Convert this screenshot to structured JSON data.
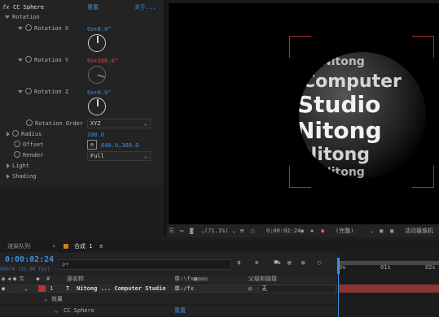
{
  "effects": {
    "fx": "fx",
    "name": "CC Sphere",
    "reset": "重置",
    "about": "关于...",
    "group_rotation": "Rotation",
    "rotation_x_label": "Rotation X",
    "rotation_x_value": "0x+0.0°",
    "rotation_y_label": "Rotation Y",
    "rotation_y_value": "0x+106.6°",
    "rotation_z_label": "Rotation Z",
    "rotation_z_value": "0x+0.0°",
    "rotation_order_label": "Rotation Order",
    "rotation_order_value": "XYZ",
    "radius_label": "Radius",
    "radius_value": "200.0",
    "offset_label": "Offset",
    "offset_value": "640.0,360.0",
    "render_label": "Render",
    "render_value": "Full",
    "light_label": "Light",
    "shading_label": "Shading"
  },
  "viewer": {
    "sphere_words": [
      "Nitong",
      "Computer",
      "Studio",
      "Nitong",
      "Nitong",
      "Nitong"
    ],
    "zoom": "(71.1%)",
    "timecode": "0:00:02:24",
    "quality": "(完整)",
    "camera": "活动摄像机"
  },
  "tabs": {
    "render_queue": "渲染队列",
    "comp": "合成 1",
    "menu": "≡"
  },
  "timeline": {
    "timecode": "0:00:02:24",
    "frame_info": "00074 (25.00 fps)",
    "search_placeholder": "ρ▾",
    "col_source_name": "源名称",
    "col_switches": "单☆\\fx▦◎◎◎",
    "col_parent": "父级和链接",
    "layer_index": "1",
    "layer_type": "T",
    "layer_name": "Nitong ... Computer Studio",
    "layer_switches": "单☆/fx",
    "parent_value": "无",
    "effects_label": "效果",
    "effect_name": "CC Sphere",
    "effect_reset": "重置",
    "ruler": [
      "0s",
      "01s",
      "02s"
    ]
  }
}
